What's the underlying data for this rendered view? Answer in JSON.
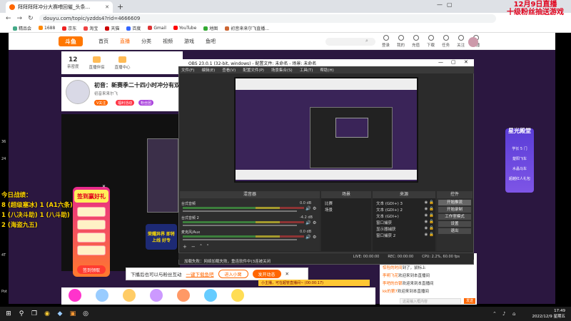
{
  "browser": {
    "tab_title": "拜拜拜拜冲分大赛喂回催_头条...",
    "url": "douyu.com/topic/yzdds4?rid=4666609",
    "bookmarks": [
      "精品会",
      "1688",
      "京东",
      "淘宝",
      "天猫",
      "百度",
      "Gmail",
      "YouTube",
      "地图",
      "初音来来尔飞直播..."
    ]
  },
  "promo_overlay": {
    "line1": "12月9日直播",
    "line2": "十级粉丝抽送游戏"
  },
  "site": {
    "logo": "斗鱼",
    "nav": [
      "首页",
      "直播",
      "分类",
      "视频",
      "游戏",
      "鱼吧"
    ],
    "header_icons": [
      "登录",
      "我的",
      "充值",
      "下载",
      "任务",
      "关注",
      "开播"
    ],
    "sub_items": [
      {
        "num": "12",
        "label": "亲密度"
      },
      {
        "label": "直播伴侣"
      },
      {
        "label": "直播中心"
      }
    ],
    "streamer": {
      "title": "初音：新赛季二十四小时冲分有双倍",
      "badge": "初音来来尔飞",
      "follow": "V关注",
      "btn1": "福利活动",
      "btn2": "粉丝团"
    }
  },
  "left_overlay": {
    "lines": [
      "今日战绩：",
      "8 (超级塞冰) 1 (A1六条)",
      "1 (八决斗助) 1 (八斗助)",
      "2 (海盗九五)"
    ],
    "mini": [
      "36",
      "24",
      "4T",
      "Pot"
    ]
  },
  "sign_widget": {
    "title": "签到赢好礼",
    "button": "签到领取"
  },
  "promo_box": "荣耀异界 即将上线 好专",
  "right_side": {
    "title": "星光殿堂",
    "items": [
      "学长 5 门",
      "楚阳飞车",
      "水晶马车",
      "超越红人礼包"
    ]
  },
  "notice": {
    "text": "下播后也可以与粉丝互动",
    "link": "一键下载鱼吧",
    "btn_in": "进入小窝",
    "btn_open": "发开动态"
  },
  "yellow_bar": "小主播，可在超管直播间~ (00:00:17)",
  "chat": {
    "lines": [
      {
        "user": "ba*6tsb",
        "text": "：搞什么日子"
      },
      {
        "user": "惊险的时间",
        "text": "到了，鼠标上"
      },
      {
        "user": "李明飞花",
        "text": "欢迎来到本直播间"
      },
      {
        "user": "李吧的白银",
        "text": "欢迎来到本直播间"
      },
      {
        "user": "kk的第7",
        "text": "欢迎来到本直播间"
      }
    ],
    "input_placeholder": "这是输入框内容",
    "send": "发送"
  },
  "obs": {
    "title": "OBS 23.0.1 (32-bit, windows) - 配置文件: 未命名 - 场景: 未命名",
    "menu": [
      "文件(F)",
      "编辑(E)",
      "查看(V)",
      "配置文件(P)",
      "场景集合(S)",
      "工具(T)",
      "帮助(H)"
    ],
    "docks": [
      "混音器",
      "场景",
      "来源",
      "控件"
    ],
    "mixer": [
      {
        "name": "台式音频",
        "db": "0.0 dB"
      },
      {
        "name": "台式音频 2",
        "db": "-4.2 dB"
      },
      {
        "name": "麦克风/Aux",
        "db": "0.0 dB"
      }
    ],
    "scenes": [
      "比赛",
      "场景"
    ],
    "sources": [
      "文本 (GDI+) 3",
      "文本 (GDI+) 2",
      "文本 (GDI+)",
      "窗口捕获",
      "显示器捕获",
      "窗口捕获 2"
    ],
    "controls": [
      "开始推流",
      "开始录制",
      "工作室模式",
      "设置",
      "退出"
    ],
    "status": [
      "LIVE: 00:00:00",
      "REC: 00:00:00",
      "CPU: 2.2%, 60.00 fps"
    ],
    "loading": "加载失败：网络加载失败，重连软件中(3连被关闭"
  },
  "taskbar": {
    "time": "17:49",
    "date": "2022/12/9 星期五"
  }
}
